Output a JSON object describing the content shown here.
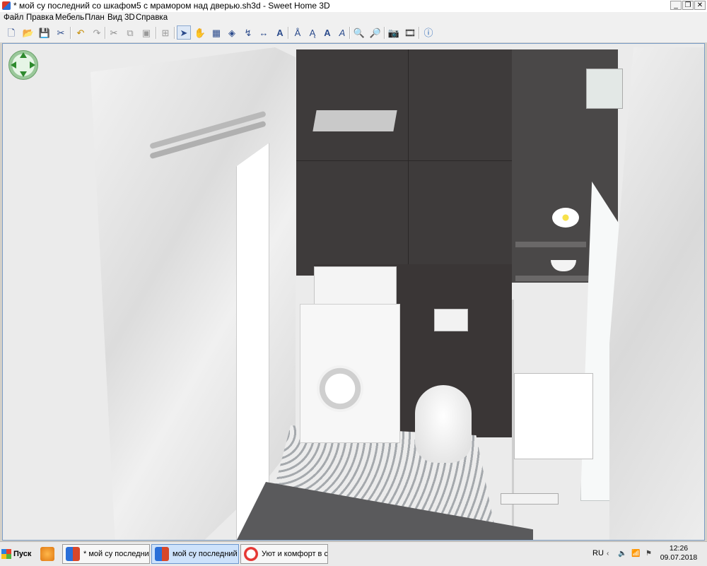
{
  "window": {
    "title": "* мой су последний со шкафом5 с мрамором над дверью.sh3d - Sweet Home 3D",
    "controls": [
      "_",
      "❐",
      "✕"
    ]
  },
  "menu": [
    "Файл",
    "Правка",
    "Мебель",
    "План",
    "Вид 3D",
    "Справка"
  ],
  "toolbar": {
    "icons": [
      "new-home-icon",
      "open-icon",
      "save-icon",
      "preferences-icon",
      "undo-icon",
      "redo-icon",
      "cut-icon",
      "copy-icon",
      "paste-icon",
      "add-furniture-icon",
      "select-icon",
      "pan-icon",
      "create-walls-icon",
      "create-rooms-icon",
      "create-polylines-icon",
      "create-dimensions-icon",
      "add-text-icon",
      "text-style-icon",
      "text-bold-icon",
      "text-italic-icon",
      "text-size-icon",
      "zoom-in-icon",
      "zoom-out-icon",
      "create-photo-icon",
      "create-video-icon",
      "help-icon"
    ]
  },
  "view3d": {
    "navigation": "navigation-arrows-icon"
  },
  "taskbar": {
    "start_label": "Пуск",
    "tasks": [
      {
        "label": "* мой су последни..."
      },
      {
        "label": "мой су последний ..."
      },
      {
        "label": "Уют и комфорт в с..."
      }
    ],
    "lang": "RU",
    "time": "12:26",
    "date": "09.07.2018"
  },
  "colors": {
    "accent": "#2b4b8c",
    "marble": "#e9e9ea",
    "dark_tile": "#3b3838",
    "floor_pattern": "#8a8f95"
  }
}
